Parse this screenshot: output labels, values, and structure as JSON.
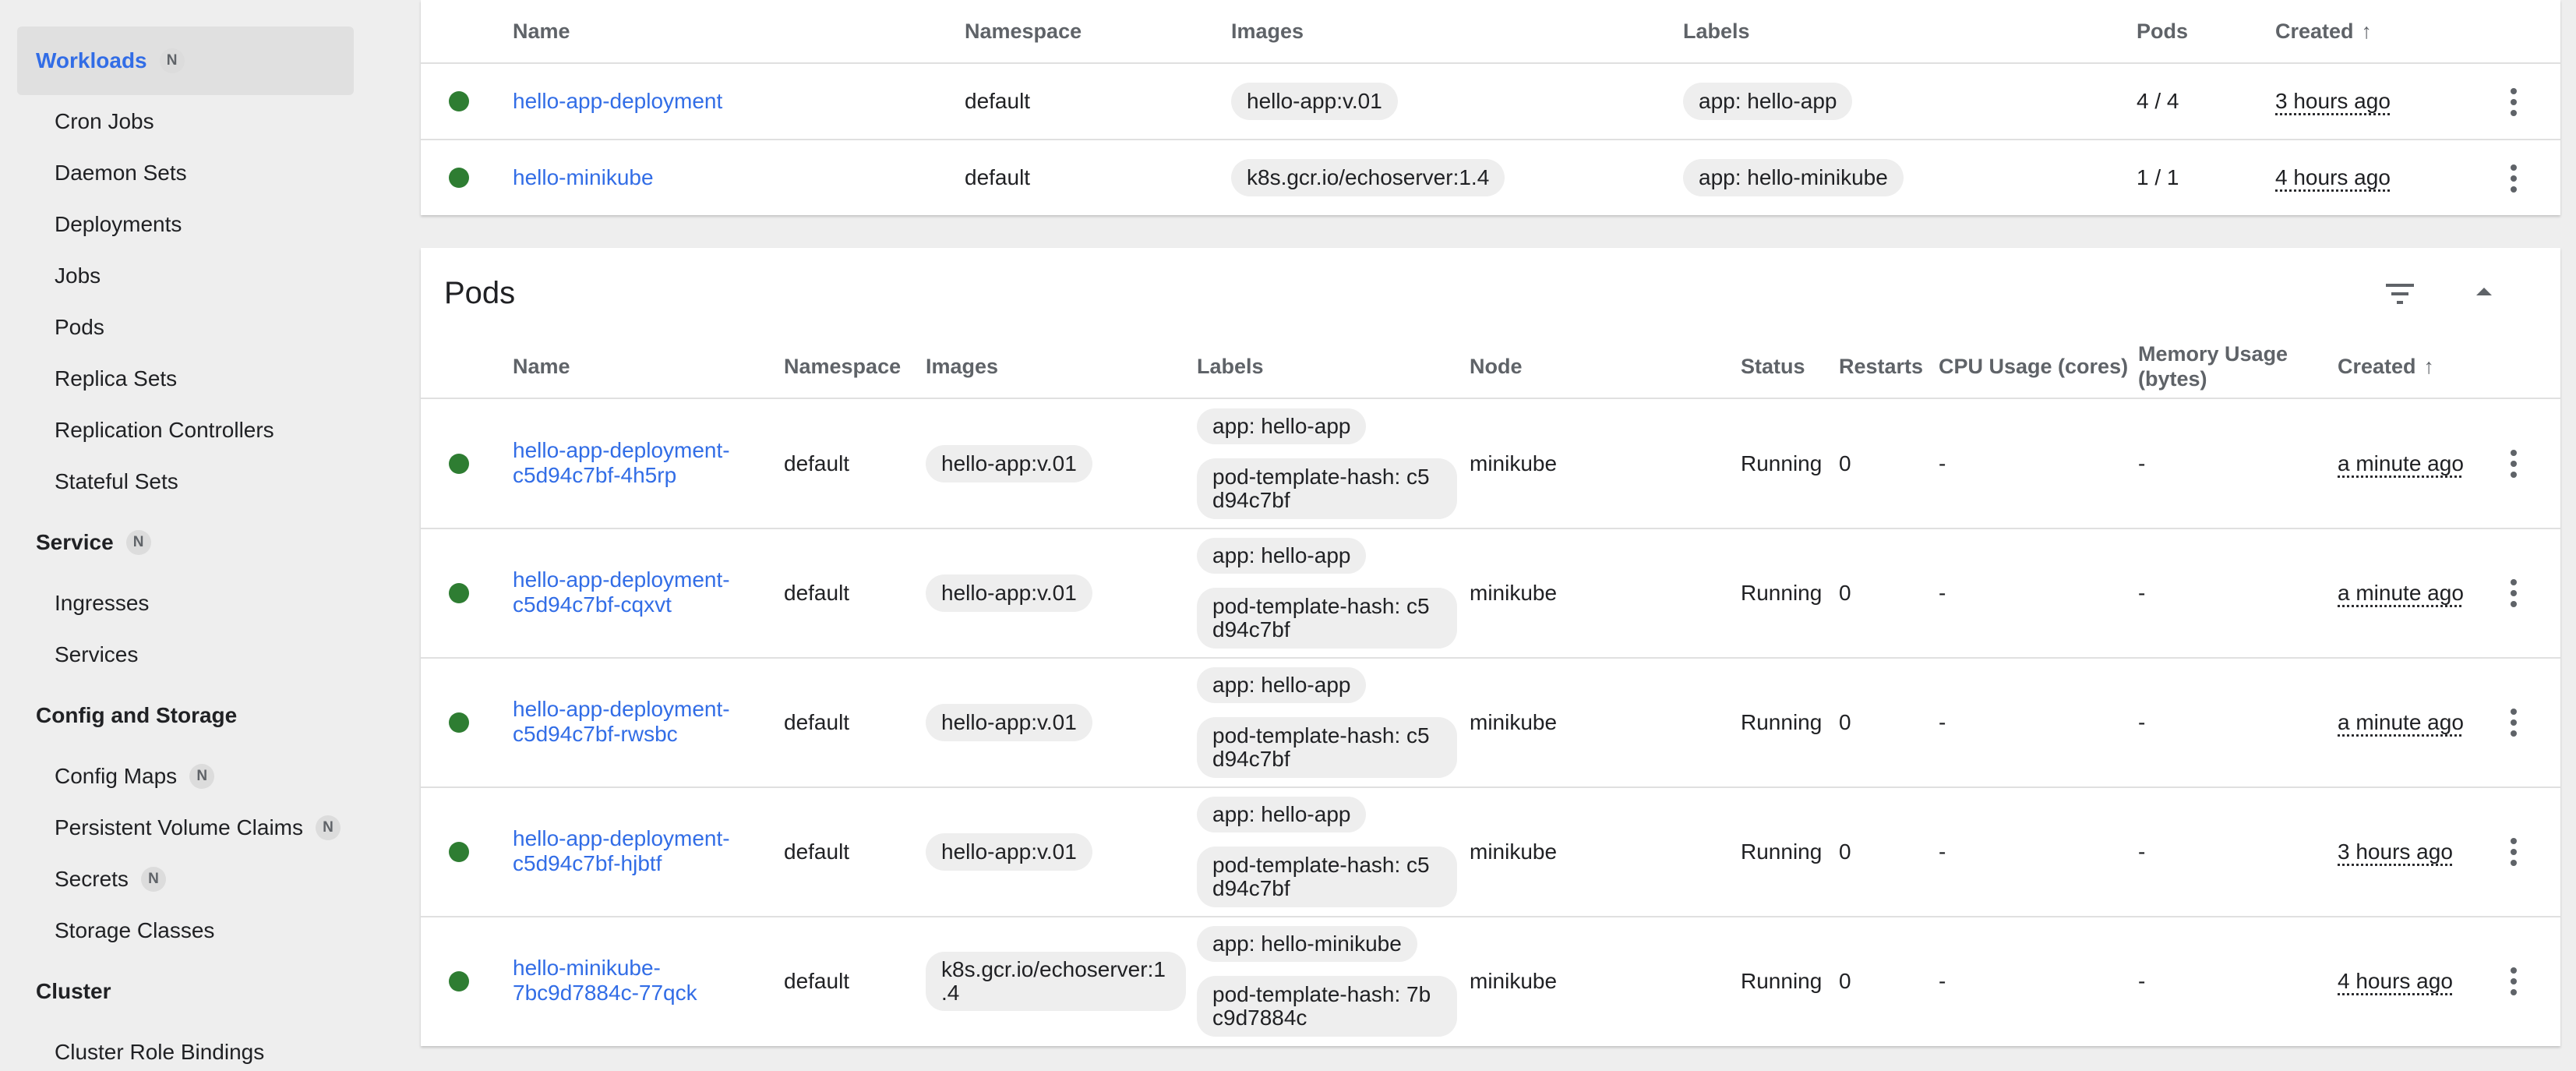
{
  "sidebar": {
    "workloads": {
      "label": "Workloads",
      "badge": "N"
    },
    "workload_items": [
      "Cron Jobs",
      "Daemon Sets",
      "Deployments",
      "Jobs",
      "Pods",
      "Replica Sets",
      "Replication Controllers",
      "Stateful Sets"
    ],
    "service": {
      "label": "Service",
      "badge": "N"
    },
    "service_items": [
      "Ingresses",
      "Services"
    ],
    "config": {
      "label": "Config and Storage"
    },
    "config_items": [
      {
        "label": "Config Maps",
        "badge": "N"
      },
      {
        "label": "Persistent Volume Claims",
        "badge": "N"
      },
      {
        "label": "Secrets",
        "badge": "N"
      },
      {
        "label": "Storage Classes",
        "badge": ""
      }
    ],
    "cluster": {
      "label": "Cluster"
    },
    "cluster_items": [
      "Cluster Role Bindings"
    ]
  },
  "deployments": {
    "headers": {
      "name": "Name",
      "namespace": "Namespace",
      "images": "Images",
      "labels": "Labels",
      "pods": "Pods",
      "created": "Created"
    },
    "sort_arrow": "↑",
    "rows": [
      {
        "name": "hello-app-deployment",
        "namespace": "default",
        "image": "hello-app:v.01",
        "label": "app: hello-app",
        "pods": "4 / 4",
        "created": "3 hours ago"
      },
      {
        "name": "hello-minikube",
        "namespace": "default",
        "image": "k8s.gcr.io/echoserver:1.4",
        "label": "app: hello-minikube",
        "pods": "1 / 1",
        "created": "4 hours ago"
      }
    ]
  },
  "pods": {
    "title": "Pods",
    "headers": {
      "name": "Name",
      "namespace": "Namespace",
      "images": "Images",
      "labels": "Labels",
      "node": "Node",
      "status": "Status",
      "restarts": "Restarts",
      "cpu": "CPU Usage (cores)",
      "memory_1": "Memory Usage",
      "memory_2": "(bytes)",
      "created": "Created"
    },
    "sort_arrow": "↑",
    "rows": [
      {
        "name_1": "hello-app-deployment-",
        "name_2": "c5d94c7bf-4h5rp",
        "namespace": "default",
        "image_1": "hello-app:v.01",
        "image_2": "",
        "label_app": "app: hello-app",
        "hash_1": "pod-template-hash: c5",
        "hash_2": "d94c7bf",
        "node": "minikube",
        "status": "Running",
        "restarts": "0",
        "cpu": "-",
        "memory": "-",
        "created": "a minute ago"
      },
      {
        "name_1": "hello-app-deployment-",
        "name_2": "c5d94c7bf-cqxvt",
        "namespace": "default",
        "image_1": "hello-app:v.01",
        "image_2": "",
        "label_app": "app: hello-app",
        "hash_1": "pod-template-hash: c5",
        "hash_2": "d94c7bf",
        "node": "minikube",
        "status": "Running",
        "restarts": "0",
        "cpu": "-",
        "memory": "-",
        "created": "a minute ago"
      },
      {
        "name_1": "hello-app-deployment-",
        "name_2": "c5d94c7bf-rwsbc",
        "namespace": "default",
        "image_1": "hello-app:v.01",
        "image_2": "",
        "label_app": "app: hello-app",
        "hash_1": "pod-template-hash: c5",
        "hash_2": "d94c7bf",
        "node": "minikube",
        "status": "Running",
        "restarts": "0",
        "cpu": "-",
        "memory": "-",
        "created": "a minute ago"
      },
      {
        "name_1": "hello-app-deployment-",
        "name_2": "c5d94c7bf-hjbtf",
        "namespace": "default",
        "image_1": "hello-app:v.01",
        "image_2": "",
        "label_app": "app: hello-app",
        "hash_1": "pod-template-hash: c5",
        "hash_2": "d94c7bf",
        "node": "minikube",
        "status": "Running",
        "restarts": "0",
        "cpu": "-",
        "memory": "-",
        "created": "3 hours ago"
      },
      {
        "name_1": "hello-minikube-",
        "name_2": "7bc9d7884c-77qck",
        "namespace": "default",
        "image_1": "k8s.gcr.io/echoserver:1",
        "image_2": ".4",
        "label_app": "app: hello-minikube",
        "hash_1": "pod-template-hash: 7b",
        "hash_2": "c9d7884c",
        "node": "minikube",
        "status": "Running",
        "restarts": "0",
        "cpu": "-",
        "memory": "-",
        "created": "4 hours ago"
      }
    ]
  },
  "colors": {
    "accent": "#326de6",
    "running": "#2e7d32",
    "active_bg": "#e0e0e0"
  }
}
